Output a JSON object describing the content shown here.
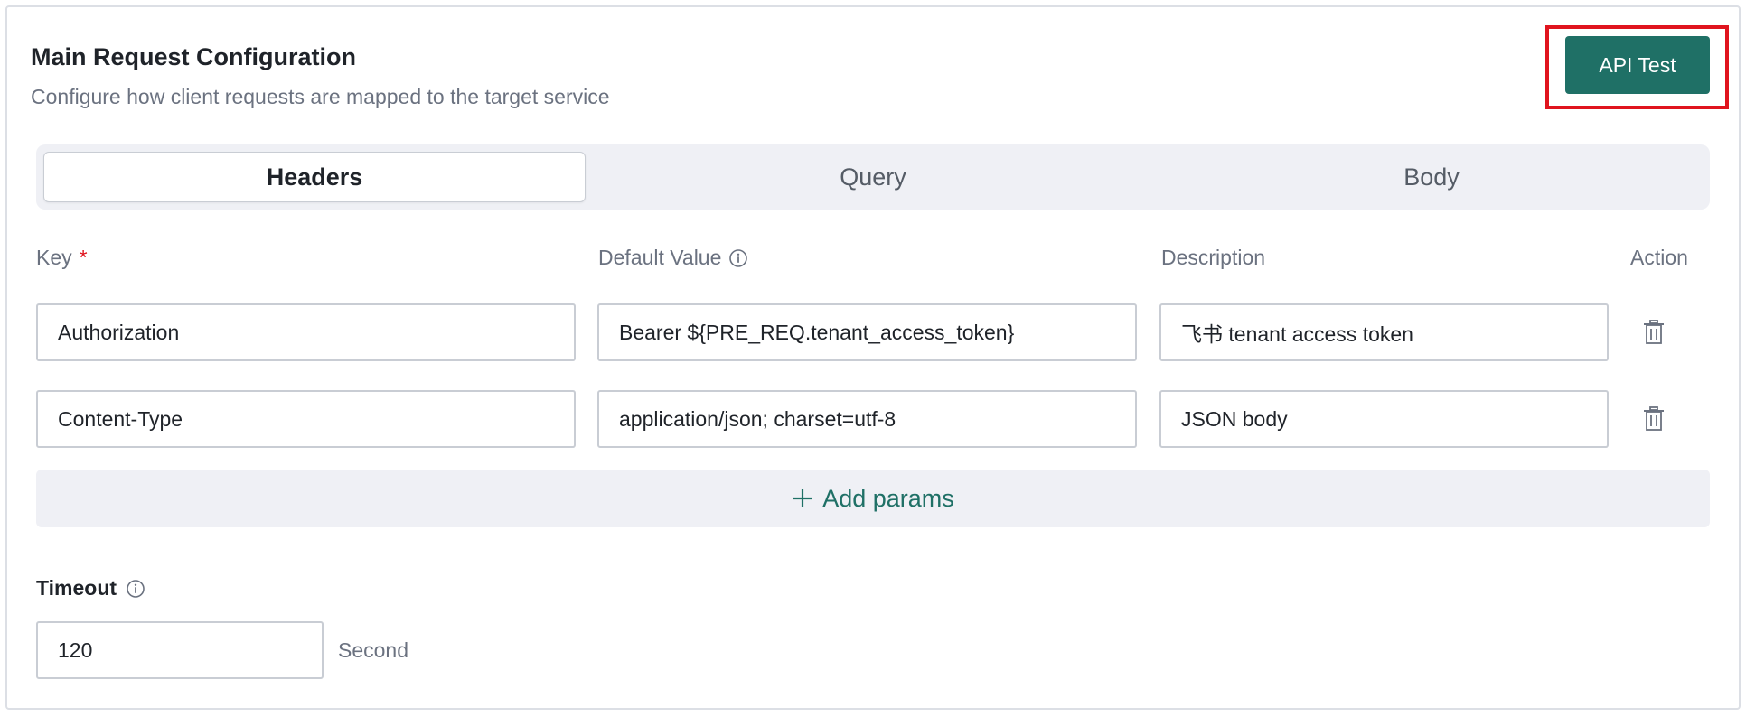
{
  "section": {
    "title": "Main Request Configuration",
    "subtitle": "Configure how client requests are mapped to the target service",
    "api_test_label": "API Test"
  },
  "tabs": [
    {
      "label": "Headers",
      "active": true
    },
    {
      "label": "Query",
      "active": false
    },
    {
      "label": "Body",
      "active": false
    }
  ],
  "columns": {
    "key": "Key",
    "key_required_mark": "*",
    "default_value": "Default Value",
    "description": "Description",
    "action": "Action"
  },
  "rows": [
    {
      "key": "Authorization",
      "default_value": "Bearer ${PRE_REQ.tenant_access_token}",
      "description": "飞书 tenant access token"
    },
    {
      "key": "Content-Type",
      "default_value": "application/json; charset=utf-8",
      "description": "JSON body"
    }
  ],
  "add_params_label": "Add params",
  "timeout": {
    "label": "Timeout",
    "value": "120",
    "unit": "Second"
  },
  "colors": {
    "accent": "#1f7066",
    "highlight_box": "#e0141e",
    "required": "#e0141e"
  },
  "icons": [
    "info-icon",
    "trash-icon",
    "plus-icon"
  ]
}
